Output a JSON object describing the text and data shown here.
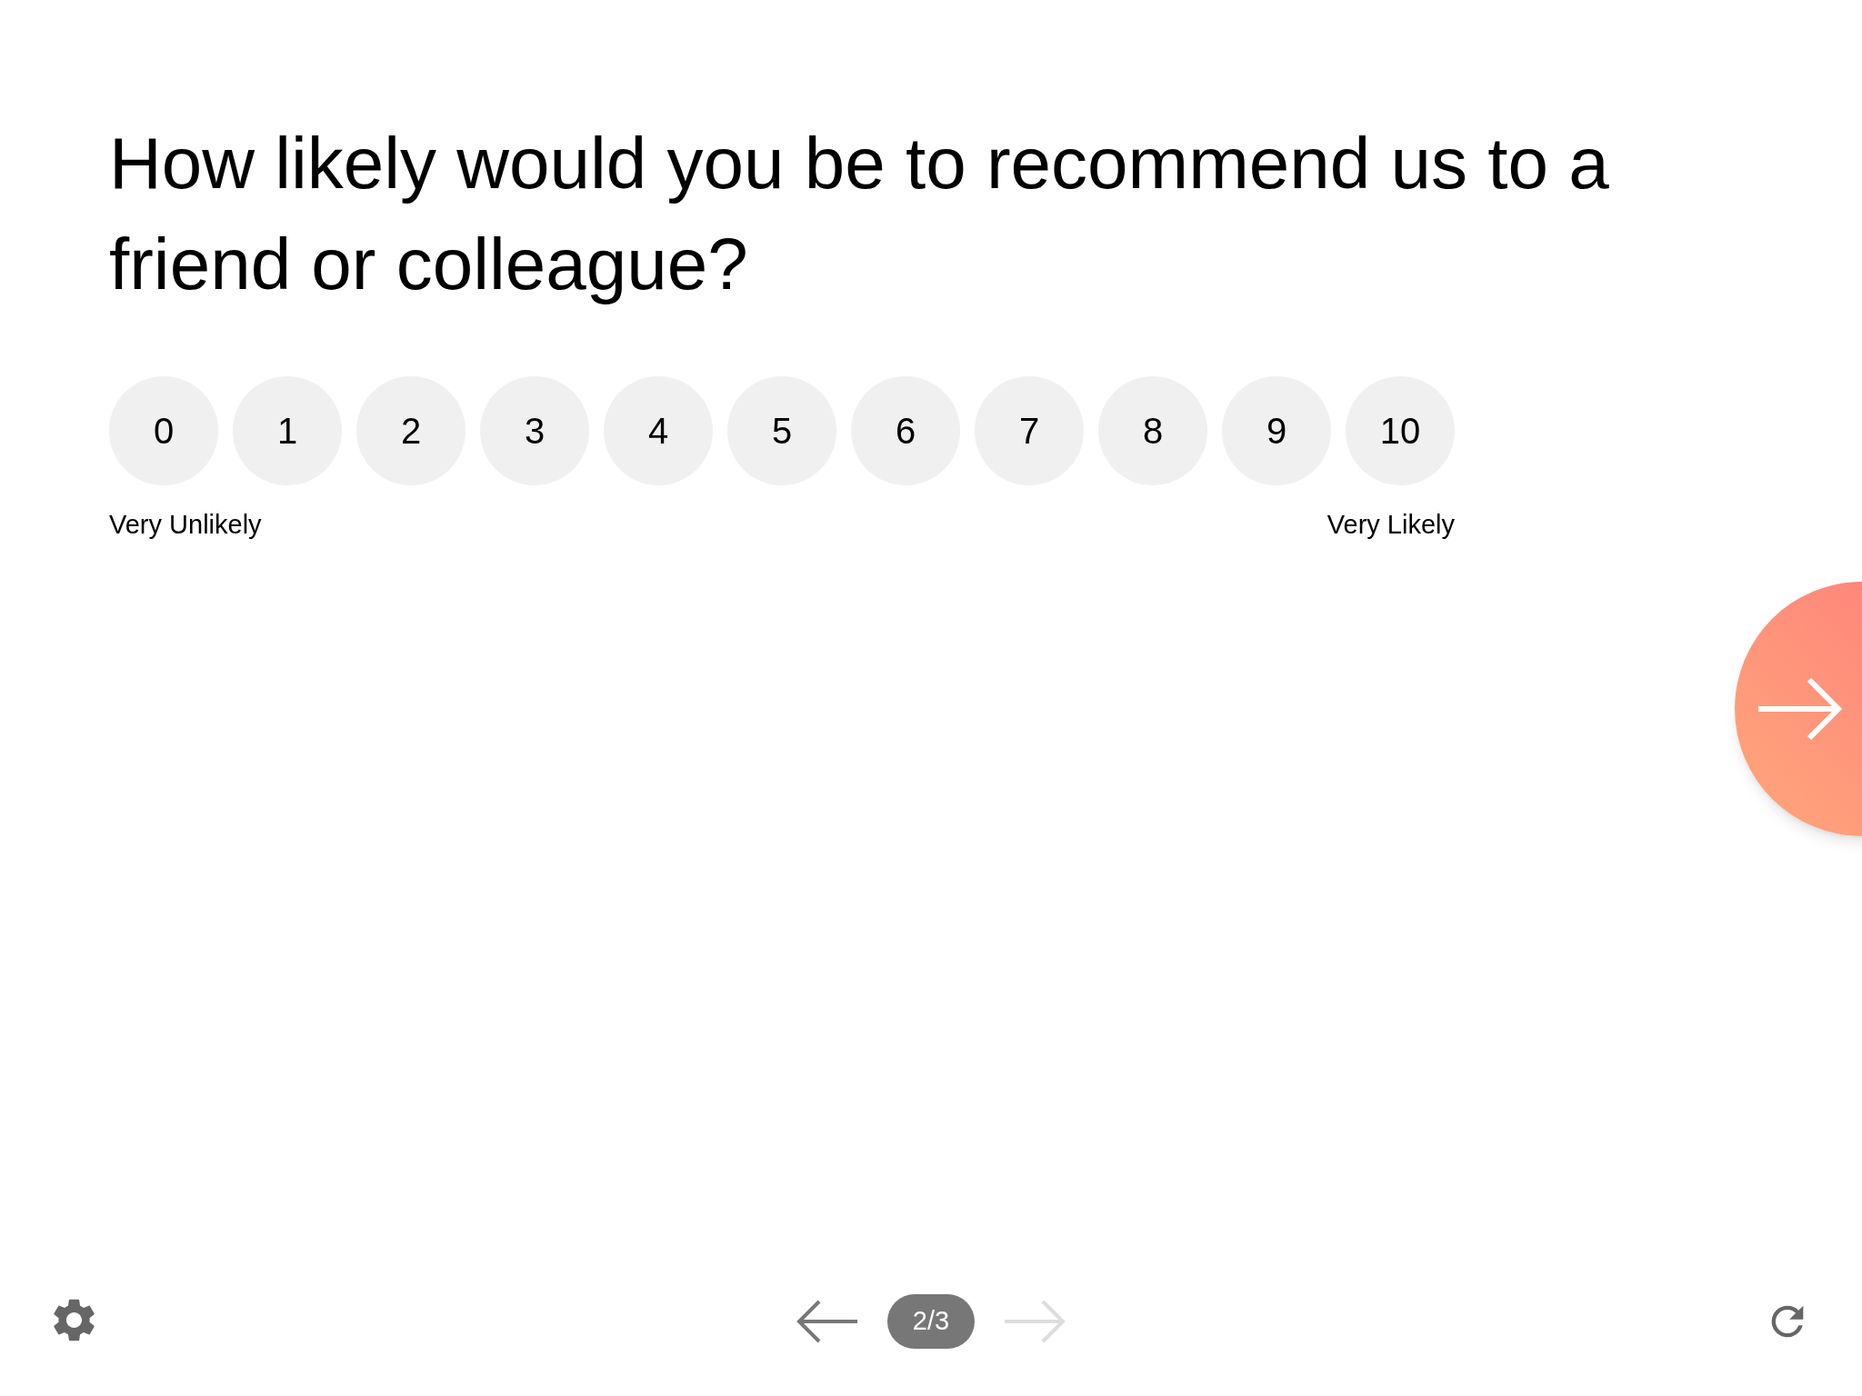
{
  "question": "How likely would you be to recommend us to a friend or colleague?",
  "scale": [
    {
      "label": "0",
      "selected": false
    },
    {
      "label": "1",
      "selected": false
    },
    {
      "label": "2",
      "selected": false
    },
    {
      "label": "3",
      "selected": false
    },
    {
      "label": "4",
      "selected": false
    },
    {
      "label": "5",
      "selected": false
    },
    {
      "label": "6",
      "selected": false
    },
    {
      "label": "7",
      "selected": false
    },
    {
      "label": "8",
      "selected": false
    },
    {
      "label": "9",
      "selected": false
    },
    {
      "label": "10",
      "selected": false
    }
  ],
  "scale_min_label": "Very Unlikely",
  "scale_max_label": "Very Likely",
  "footer": {
    "previous_disabled": false,
    "next_disabled": true,
    "page": "2/3"
  }
}
